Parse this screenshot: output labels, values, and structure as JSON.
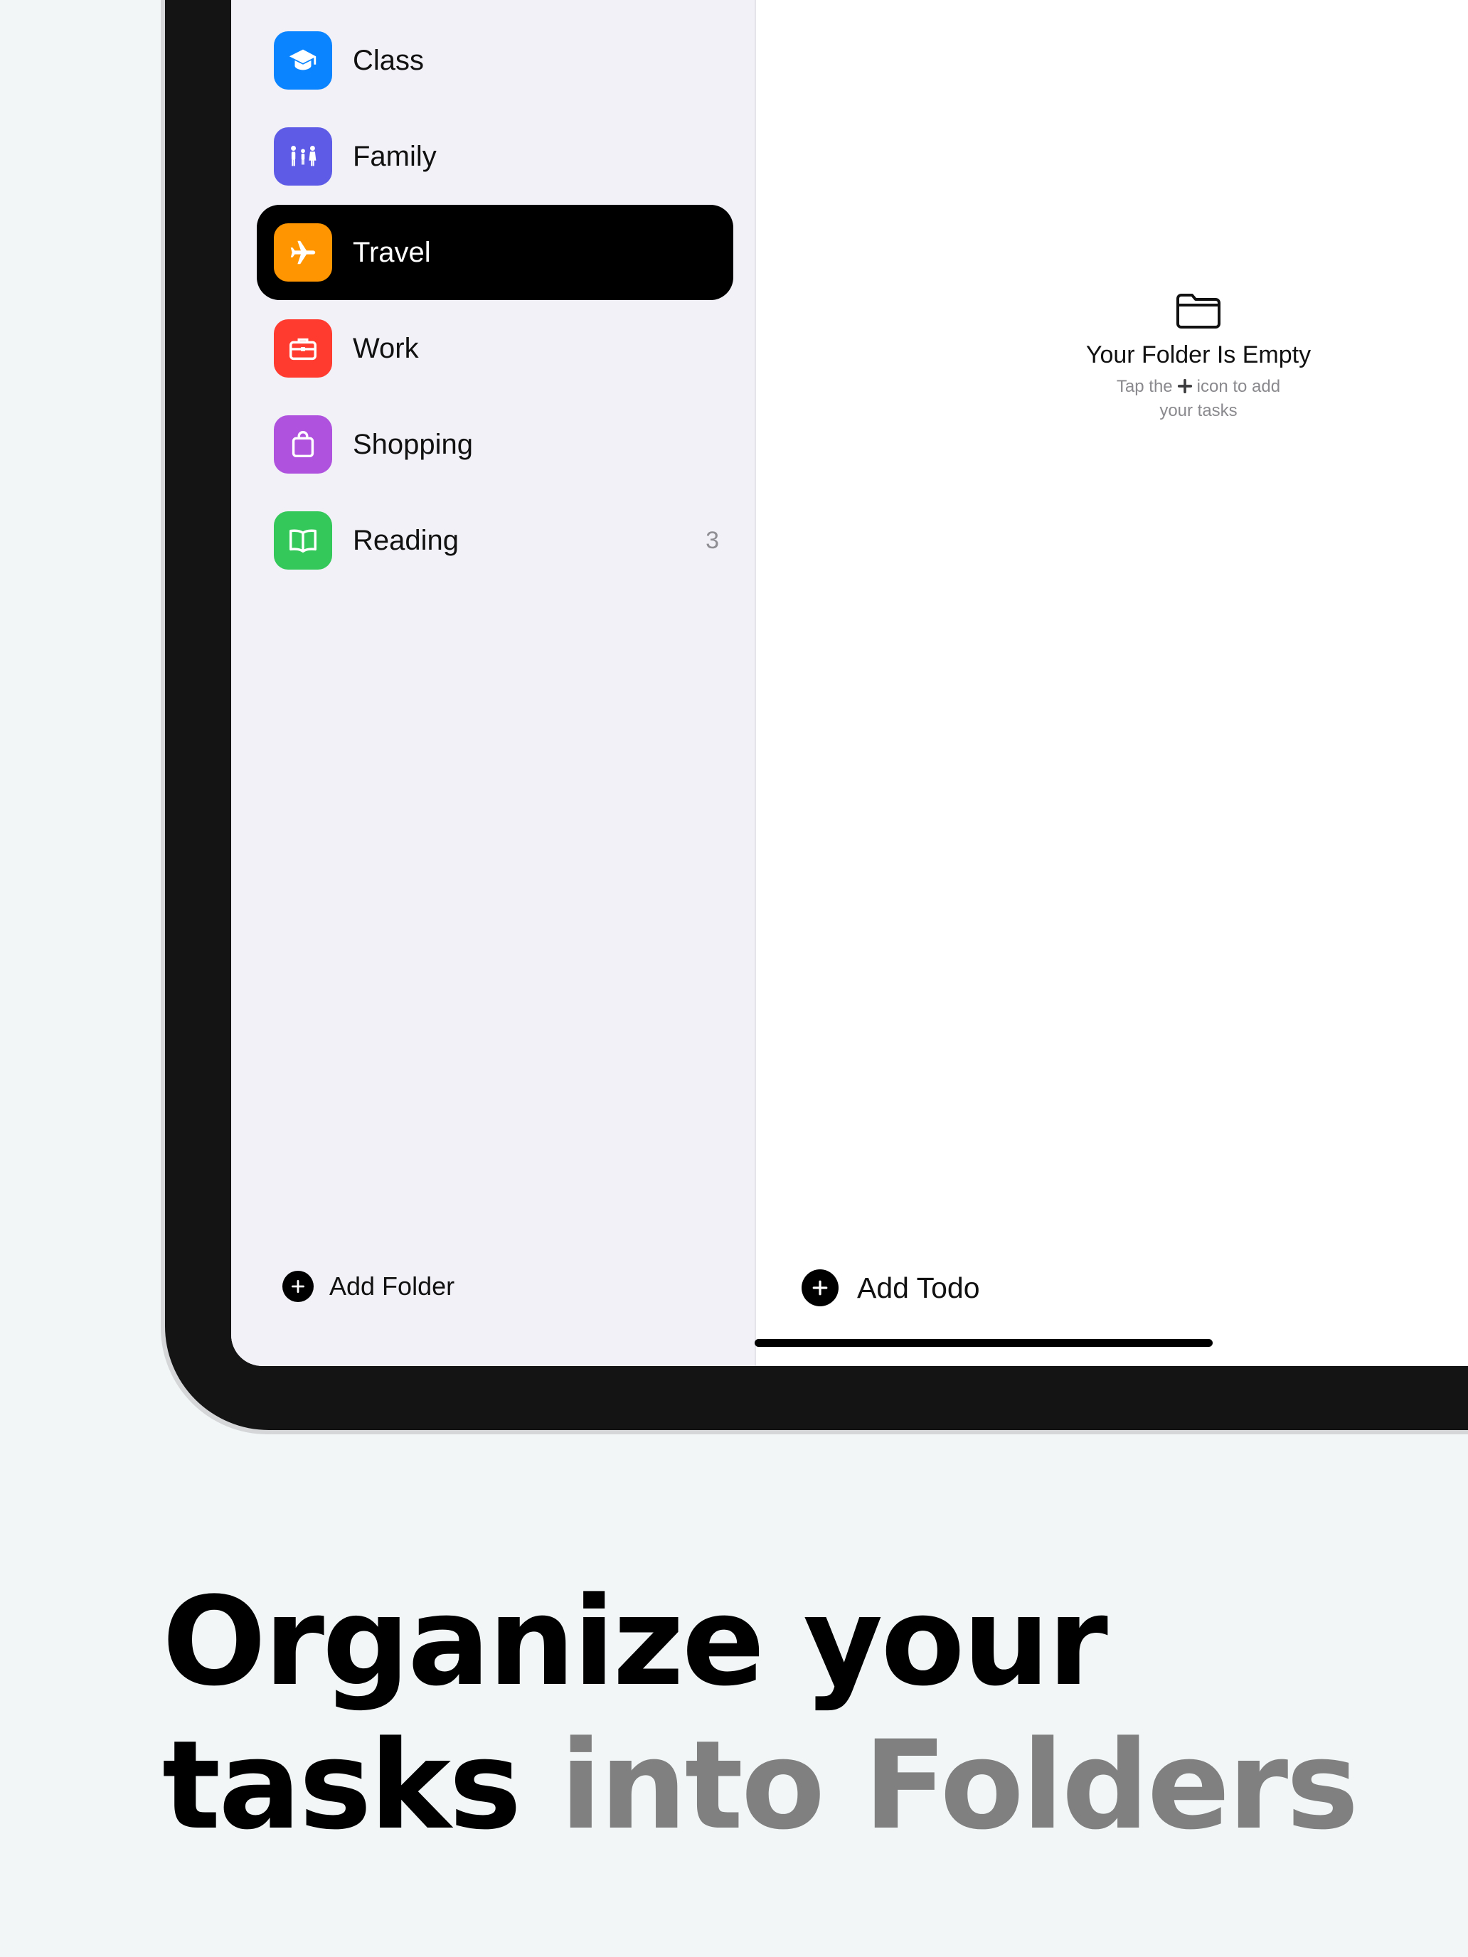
{
  "sidebar": {
    "folders": [
      {
        "label": "Class",
        "icon": "graduation-cap-icon",
        "color": "#0a84ff",
        "count": ""
      },
      {
        "label": "Family",
        "icon": "family-icon",
        "color": "#5e5ce6",
        "count": ""
      },
      {
        "label": "Travel",
        "icon": "airplane-icon",
        "color": "#ff9500",
        "count": "",
        "selected": true
      },
      {
        "label": "Work",
        "icon": "briefcase-icon",
        "color": "#ff3b30",
        "count": ""
      },
      {
        "label": "Shopping",
        "icon": "shopping-bag-icon",
        "color": "#af52de",
        "count": ""
      },
      {
        "label": "Reading",
        "icon": "book-icon",
        "color": "#34c759",
        "count": "3"
      }
    ],
    "add_folder_label": "Add Folder"
  },
  "main": {
    "empty_title": "Your Folder Is Empty",
    "empty_sub_before": "Tap the",
    "empty_sub_after": "icon to add",
    "empty_sub_line2": "your tasks",
    "add_todo_label": "Add Todo"
  },
  "caption": {
    "line1": "Organize your",
    "line2_dark": "tasks",
    "line2_muted": "into Folders"
  },
  "colors": {
    "background": "#f2f6f7",
    "sidebar": "#f2f1f7",
    "selected": "#000000",
    "muted_text": "#808080"
  }
}
